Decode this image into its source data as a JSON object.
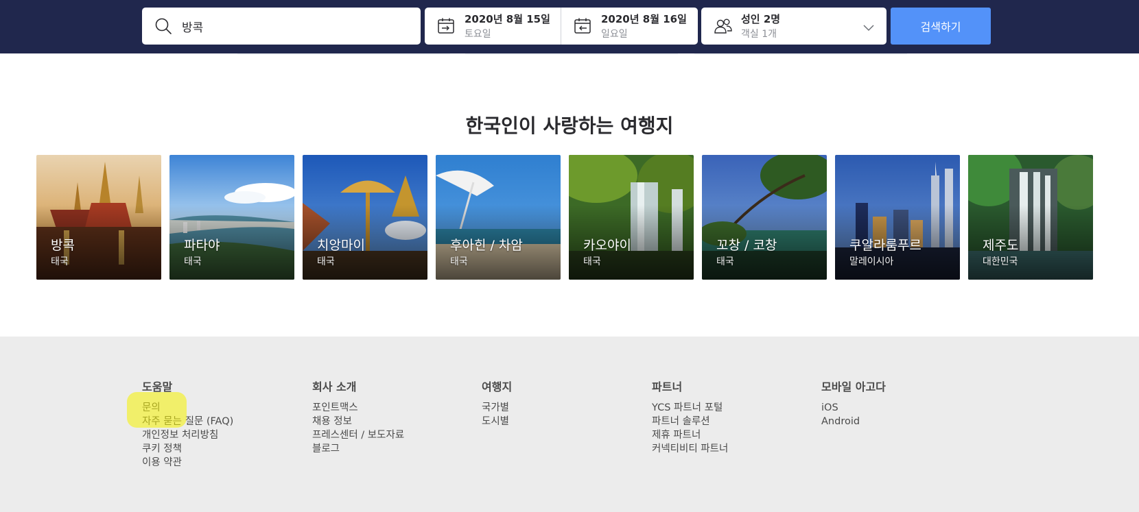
{
  "search": {
    "query": "방콕",
    "checkin": {
      "date": "2020년 8월 15일",
      "day": "토요일"
    },
    "checkout": {
      "date": "2020년 8월 16일",
      "day": "일요일"
    },
    "guests": {
      "main": "성인 2명",
      "sub": "객실 1개"
    },
    "button_label": "검색하기",
    "icons": [
      "search-icon",
      "calendar-checkin-icon",
      "calendar-checkout-icon",
      "guests-icon",
      "chevron-down-icon"
    ]
  },
  "destinations": {
    "title": "한국인이 사랑하는 여행지",
    "items": [
      {
        "name": "방콕",
        "country": "태국"
      },
      {
        "name": "파타야",
        "country": "태국"
      },
      {
        "name": "치앙마이",
        "country": "태국"
      },
      {
        "name": "후아힌 / 차암",
        "country": "태국"
      },
      {
        "name": "카오야이",
        "country": "태국"
      },
      {
        "name": "꼬창 / 코창",
        "country": "태국"
      },
      {
        "name": "쿠알라룸푸르",
        "country": "말레이시아"
      },
      {
        "name": "제주도",
        "country": "대한민국"
      }
    ]
  },
  "footer": {
    "columns": [
      {
        "heading": "도움말",
        "links": [
          "문의",
          "자주 묻는 질문 (FAQ)",
          "개인정보 처리방침",
          "쿠키 정책",
          "이용 약관"
        ]
      },
      {
        "heading": "회사 소개",
        "links": [
          "포인트맥스",
          "채용 정보",
          "프레스센터 / 보도자료",
          "블로그"
        ]
      },
      {
        "heading": "여행지",
        "links": [
          "국가별",
          "도시별"
        ]
      },
      {
        "heading": "파트너",
        "links": [
          "YCS 파트너 포털",
          "파트너 솔루션",
          "제휴 파트너",
          "커넥티비티 파트너"
        ]
      },
      {
        "heading": "모바일 아고다",
        "links": [
          "iOS",
          "Android"
        ]
      }
    ]
  },
  "colors": {
    "header_bg": "#20274d",
    "search_button": "#5392f9",
    "footer_bg": "#ececec",
    "highlight": "#f6f300"
  }
}
